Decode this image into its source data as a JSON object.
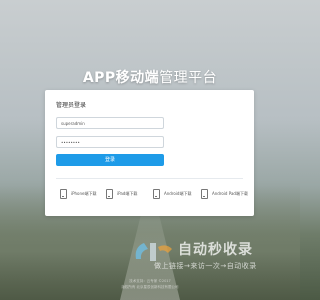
{
  "title": {
    "bold": "APP移动端",
    "light": "管理平台"
  },
  "login": {
    "heading": "管理员登录",
    "username_value": "superadmin",
    "password_value": "••••••••",
    "submit_label": "登录"
  },
  "downloads": [
    {
      "label": "iPhone端下载",
      "icon": "iphone-icon"
    },
    {
      "label": "iPad端下载",
      "icon": "ipad-icon"
    },
    {
      "label": "Android端下载",
      "icon": "android-phone-icon"
    },
    {
      "label": "Android Pad端下载",
      "icon": "android-pad-icon"
    }
  ],
  "watermark": {
    "main": "自动秒收录",
    "sub": "做上链接→来访一次→自动收录"
  },
  "footer": {
    "line1": "技术支持：云专家 ©2017",
    "line2": "版权所有 北京星辰创新科技有限公司"
  },
  "colors": {
    "accent": "#1e9be8"
  }
}
